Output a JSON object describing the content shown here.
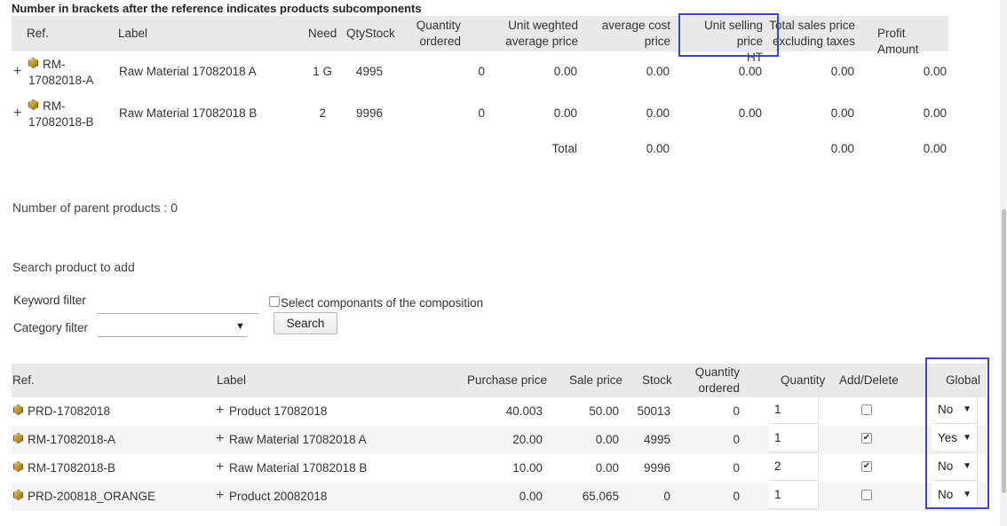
{
  "subcomponents": {
    "heading": "Number in brackets after the reference indicates products subcomponents",
    "headers": {
      "ref": "Ref.",
      "label": "Label",
      "need": "Need",
      "qtystock": "QtyStock",
      "qty_ordered_1": "Quantity",
      "qty_ordered_2": "ordered",
      "unit_weighted_1": "Unit weghted",
      "unit_weighted_2": "average price",
      "avg_cost_1": "average cost",
      "avg_cost_2": "price",
      "unit_selling_1": "Unit selling price",
      "unit_selling_2": "HT",
      "total_sales_1": "Total sales price",
      "total_sales_2": "excluding taxes",
      "profit": "Profit Amount"
    },
    "rows": [
      {
        "ref_1": "RM-",
        "ref_2": "17082018-A",
        "label": "Raw Material 17082018 A",
        "need": "1 G",
        "qtystock": "4995",
        "qty_ordered": "0",
        "unit_weighted": "0.00",
        "avg_cost": "0.00",
        "unit_selling": "0.00",
        "total_sales": "0.00",
        "profit": "0.00"
      },
      {
        "ref_1": "RM-",
        "ref_2": "17082018-B",
        "label": "Raw Material 17082018 B",
        "need": "2",
        "qtystock": "9996",
        "qty_ordered": "0",
        "unit_weighted": "0.00",
        "avg_cost": "0.00",
        "unit_selling": "0.00",
        "total_sales": "0.00",
        "profit": "0.00"
      }
    ],
    "total": {
      "label": "Total",
      "avg_cost": "0.00",
      "total_sales": "0.00",
      "profit": "0.00"
    }
  },
  "parents": {
    "label": "Number of parent products : 0"
  },
  "search": {
    "heading": "Search product to add",
    "keyword_label": "Keyword filter",
    "keyword_value": "",
    "category_label": "Category filter",
    "category_value": "",
    "checkbox_label": "Select componants of the composition",
    "button_label": "Search"
  },
  "results": {
    "headers": {
      "ref": "Ref.",
      "label": "Label",
      "purchase": "Purchase price",
      "sale": "Sale price",
      "stock": "Stock",
      "qty_ordered_1": "Quantity",
      "qty_ordered_2": "ordered",
      "quantity": "Quantity",
      "add_delete": "Add/Delete",
      "global": "Global"
    },
    "rows": [
      {
        "ref": "PRD-17082018",
        "label": "Product 17082018",
        "purchase": "40.003",
        "sale": "50.00",
        "stock": "50013",
        "qty_ordered": "0",
        "quantity": "1",
        "checked": false,
        "global": "No"
      },
      {
        "ref": "RM-17082018-A",
        "label": "Raw Material 17082018 A",
        "purchase": "20.00",
        "sale": "0.00",
        "stock": "4995",
        "qty_ordered": "0",
        "quantity": "1",
        "checked": true,
        "global": "Yes"
      },
      {
        "ref": "RM-17082018-B",
        "label": "Raw Material 17082018 B",
        "purchase": "10.00",
        "sale": "0.00",
        "stock": "9996",
        "qty_ordered": "0",
        "quantity": "2",
        "checked": true,
        "global": "No"
      },
      {
        "ref": "PRD-200818_ORANGE",
        "label": "Product 20082018",
        "purchase": "0.00",
        "sale": "65.065",
        "stock": "0",
        "qty_ordered": "0",
        "quantity": "1",
        "checked": false,
        "global": "No"
      }
    ]
  },
  "icons": {
    "product": "product-box-icon",
    "expand": "plus-icon",
    "dropdown": "caret-down-icon"
  },
  "colors": {
    "link": "#263c8a",
    "highlight_box": "#3c46c0",
    "header_bg": "#e9e9e9"
  }
}
